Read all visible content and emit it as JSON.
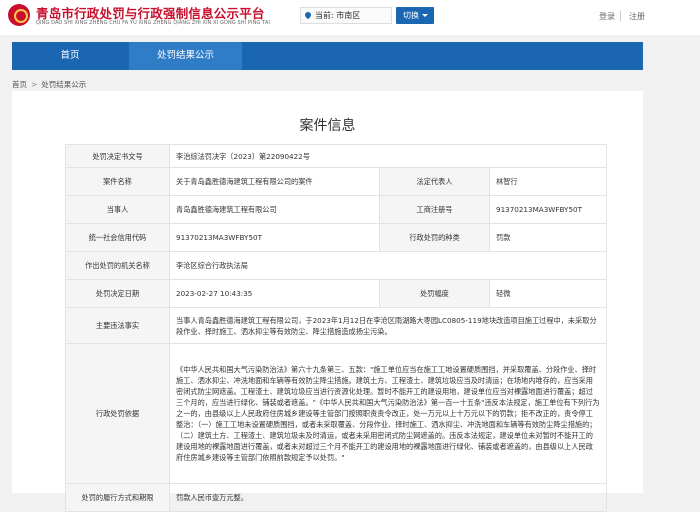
{
  "header": {
    "title": "青岛市行政处罚与行政强制信息公示平台",
    "subtitle": "QING DAO SHI XING ZHENG CHU FA YU XING ZHENG QIANG ZHI XIN XI GONG SHI PING TAI",
    "location": "当前: 市南区",
    "switch_label": "切换",
    "login_label": "登录",
    "register_label": "注册"
  },
  "nav": {
    "home": "首页",
    "results": "处罚结果公示"
  },
  "breadcrumb": {
    "home": "首页",
    "sep": ">",
    "current": "处罚结果公示"
  },
  "case": {
    "section_title": "案件信息",
    "labels": {
      "decision_no": "处罚决定书文号",
      "case_name": "案件名称",
      "legal_rep": "法定代表人",
      "party": "当事人",
      "business_reg_no": "工商注册号",
      "credit_code": "统一社会信用代码",
      "penalty_type": "行政处罚的种类",
      "authority": "作出处罚的机关名称",
      "decision_date": "处罚决定日期",
      "penalty_range": "处罚幅度",
      "violation_facts": "主要违法事实",
      "basis": "行政处罚依据",
      "performance": "处罚的履行方式和期限"
    },
    "values": {
      "decision_no": "李治综法罚决字〔2023〕第22090422号",
      "case_name": "关于青岛鑫胜德海建筑工程有限公司的案件",
      "legal_rep": "林智行",
      "party": "青岛鑫胜德海建筑工程有限公司",
      "business_reg_no": "91370213MA3WFBY50T",
      "credit_code": "91370213MA3WFBY50T",
      "penalty_type": "罚款",
      "authority": "李沧区综合行政执法局",
      "decision_date": "2023-02-27 10:43:35",
      "penalty_range": "轻微",
      "violation_facts": "当事人青岛鑫胜德海建筑工程有限公司，于2023年1月12日在李沧区雨湖路大枣园LC0805-119地块改造项目施工过程中，未采取分段作业、择时施工、洒水抑尘等有效防尘、降尘措施造成扬尘污染。",
      "basis": "《中华人民共和国大气污染防治法》第六十九条第三、五款：\"施工单位应当在施工工地设置硬质围挡，并采取覆盖、分段作业、择时施工、洒水抑尘、冲洗地面和车辆等有效防尘降尘措施。建筑土方、工程渣土、建筑垃圾应当及时清运；在场地内堆存的，应当采用密闭式防尘网遮盖。工程渣土、建筑垃圾应当进行资源化处理。暂时不能开工的建设用地，建设单位应当对裸露地面进行覆盖；超过三个月的，应当进行绿化、铺装或者遮盖。\"《中华人民共和国大气污染防治法》第一百一十五条\"违反本法规定，施工单位有下列行为之一的，由县级以上人民政府住房城乡建设等主管部门按照职责责令改正，处一万元以上十万元以下的罚款；拒不改正的，责令停工整治：（一）施工工地未设置硬质围挡，或者未采取覆盖、分段作业、择时施工、洒水抑尘、冲洗地面和车辆等有效防尘降尘措施的；（二）建筑土方、工程渣土、建筑垃圾未及时清运，或者未采用密闭式防尘网遮盖的。违反本法规定，建设单位未对暂时不能开工的建设用地的裸露地面进行覆盖，或者未对超过三个月不能开工的建设用地的裸露地面进行绿化、铺装或者遮盖的，由县级以上人民政府住房城乡建设等主管部门依照前款规定予以处罚。\"",
      "performance": "罚款人民币壹万元整。"
    }
  },
  "colors": {
    "brand_red": "#c8102e",
    "nav_blue": "#1b66b3",
    "page_bg": "#f1f1f1"
  }
}
